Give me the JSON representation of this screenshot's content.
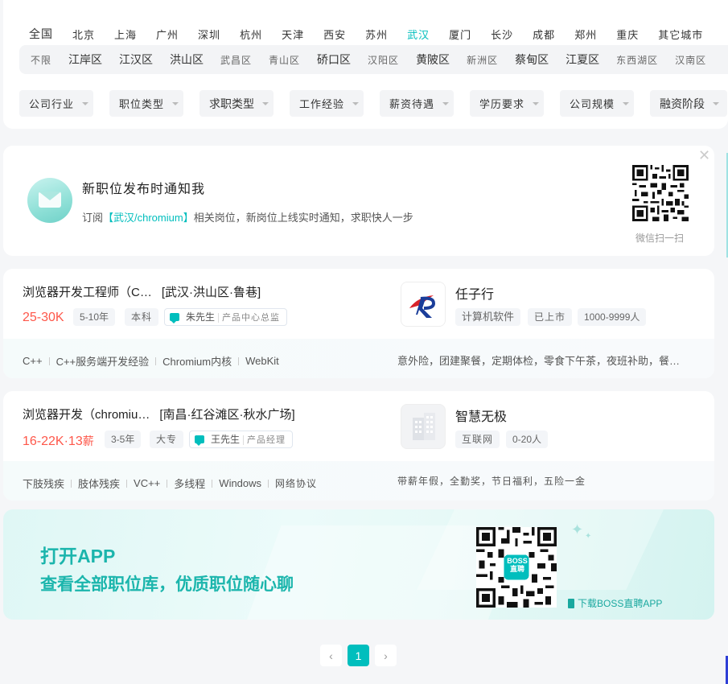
{
  "cities": [
    "全国",
    "北京",
    "上海",
    "广州",
    "深圳",
    "杭州",
    "天津",
    "西安",
    "苏州",
    "武汉",
    "厦门",
    "长沙",
    "成都",
    "郑州",
    "重庆",
    "其它城市"
  ],
  "active_city": "武汉",
  "districts": [
    "不限",
    "江岸区",
    "江汉区",
    "洪山区",
    "武昌区",
    "青山区",
    "硚口区",
    "汉阳区",
    "黄陂区",
    "新洲区",
    "蔡甸区",
    "江夏区",
    "东西湖区",
    "汉南区"
  ],
  "filters": [
    "公司行业",
    "职位类型",
    "求职类型",
    "工作经验",
    "薪资待遇",
    "学历要求",
    "公司规模",
    "融资阶段"
  ],
  "subscribe": {
    "title": "新职位发布时通知我",
    "desc_prefix": "订阅",
    "keyword": "【武汉/chromium】",
    "desc_suffix": "相关岗位，新岗位上线实时通知，求职快人一步",
    "qr_label": "微信扫一扫"
  },
  "jobs": [
    {
      "title": "浏览器开发工程师（C…",
      "location": "[武汉·洪山区·鲁巷]",
      "salary": "25-30K",
      "salary_extra": "",
      "experience": "5-10年",
      "education": "本科",
      "boss_name": "朱先生",
      "boss_role": "产品中心总监",
      "skills": [
        "C++",
        "C++服务端开发经验",
        "Chromium内核",
        "WebKit"
      ],
      "welfare": "意外险，团建聚餐，定期体检，零食下午茶，夜班补助，餐…",
      "company": "任子行",
      "company_tags": [
        "计算机软件",
        "已上市",
        "1000-9999人"
      ]
    },
    {
      "title": "浏览器开发（chromiu…",
      "location": "[南昌·红谷滩区·秋水广场]",
      "salary": "16-22K·13",
      "salary_extra": "薪",
      "experience": "3-5年",
      "education": "大专",
      "boss_name": "王先生",
      "boss_role": "产品经理",
      "skills": [
        "下肢残疾",
        "肢体残疾",
        "VC++",
        "多线程",
        "Windows",
        "网络协议"
      ],
      "welfare": "带薪年假，全勤奖，节日福利，五险一金",
      "company": "智慧无极",
      "company_tags": [
        "互联网",
        "0-20人"
      ]
    }
  ],
  "app_banner": {
    "title": "打开APP",
    "subtitle": "查看全部职位库，优质职位随心聊",
    "download": "下载BOSS直聘APP",
    "qr_badge": "BOSS直聘"
  },
  "pagination": {
    "prev": "‹",
    "current": "1",
    "next": "›"
  },
  "colors": {
    "accent": "#00bebd",
    "salary": "#fe574a"
  }
}
